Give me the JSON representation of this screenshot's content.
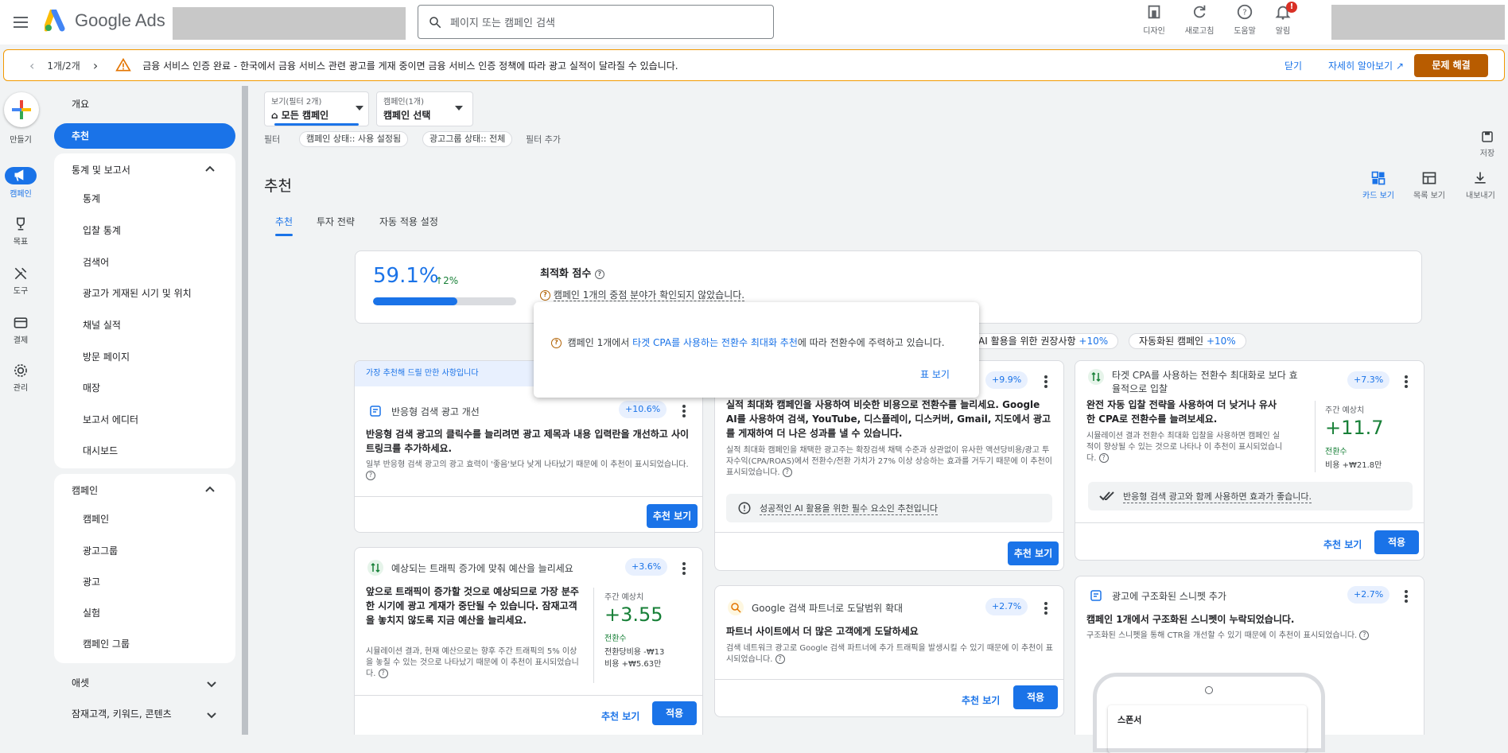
{
  "app": {
    "name": "Google Ads"
  },
  "search": {
    "placeholder": "페이지 또는 캠페인 검색"
  },
  "top_icons": [
    {
      "label": "디자인",
      "icon": "design-icon"
    },
    {
      "label": "새로고침",
      "icon": "refresh-icon"
    },
    {
      "label": "도움말",
      "icon": "help-icon"
    },
    {
      "label": "알림",
      "icon": "bell-icon",
      "badge": "!"
    }
  ],
  "banner": {
    "pager": "1개/2개",
    "title": "금융 서비스 인증 완료",
    "message": " - 한국에서 금융 서비스 관련 광고를 게재 중이면 금융 서비스 인증 정책에 따라 광고 실적이 달라질 수 있습니다.",
    "close": "닫기",
    "learn_more": "자세히 알아보기",
    "fix": "문제 해결"
  },
  "rail": [
    {
      "label": "만들기"
    },
    {
      "label": "캠페인"
    },
    {
      "label": "목표"
    },
    {
      "label": "도구"
    },
    {
      "label": "결제"
    },
    {
      "label": "관리"
    }
  ],
  "sidebar": {
    "overview": "개요",
    "recommendations": "추천",
    "stats_group": {
      "title": "통계 및 보고서",
      "items": [
        "통계",
        "입찰 통계",
        "검색어",
        "광고가 게재된 시기 및 위치",
        "채널 실적",
        "방문 페이지",
        "매장",
        "보고서 에디터",
        "대시보드"
      ]
    },
    "campaign_group": {
      "title": "캠페인",
      "items": [
        "캠페인",
        "광고그룹",
        "광고",
        "실험",
        "캠페인 그룹"
      ]
    },
    "assets": "애셋",
    "audience": "잠재고객, 키워드, 콘텐츠"
  },
  "filters": {
    "view_label": "보기(필터 2개)",
    "view_value": "모든 캠페인",
    "campaign_label": "캠페인(1개)",
    "campaign_value": "캠페인 선택",
    "filter_label": "필터",
    "chips": [
      "캠페인 상태:: 사용 설정됨",
      "광고그룹 상태:: 전체"
    ],
    "add_filter": "필터 추가",
    "save": "저장"
  },
  "page": {
    "title": "추천",
    "views": [
      "카드 보기",
      "목록 보기",
      "내보내기"
    ],
    "tabs": [
      "추천",
      "투자 전략",
      "자동 적용 설정"
    ]
  },
  "score": {
    "value": "59.1%",
    "delta": "2%",
    "progress": 0.591,
    "title": "최적화 점수",
    "subtitle": "캠페인 1개의 중점 분야가 확인되지 않았습니다."
  },
  "popup": {
    "text_before": "캠페인 1개에서 ",
    "link": "타겟 CPA를 사용하는 전환수 최대화 추천",
    "text_after": "에 따라 전환수에 주력하고 있습니다.",
    "more": "표 보기"
  },
  "categories": [
    {
      "label": "AI 활용을 위한 권장사항",
      "pct": "+10%"
    },
    {
      "label": "자동화된 캠페인",
      "pct": "+10%"
    }
  ],
  "cards": {
    "rsa": {
      "strip": "가장 추천해 드릴 만한 사항입니다",
      "head": "반응형 검색 광고 개선",
      "pct": "+10.6%",
      "title": "반응형 검색 광고의 클릭수를 늘리려면 광고 제목과 내용 입력란을 개선하고 사이트링크를 추가하세요.",
      "desc": "일부 반응형 검색 광고의 광고 효력이 '좋음'보다 낮게 나타났기 때문에 이 추천이 표시되었습니다.",
      "view": "추천 보기"
    },
    "pmax": {
      "pct": "+9.9%",
      "title": "실적 최대화 캠페인을 사용하여 비슷한 비용으로 전환수를 늘리세요. Google AI를 사용하여 검색, YouTube, 디스플레이, 디스커버, Gmail, 지도에서 광고를 게재하여 더 나은 성과를 낼 수 있습니다.",
      "desc": "실적 최대화 캠페인을 채택한 광고주는 확장검색 채택 수준과 상관없이 유사한 액션당비용/광고 투자수익(CPA/ROAS)에서 전환수/전환 가치가 27% 이상 상승하는 효과를 거두기 때문에 이 추천이 표시되었습니다.",
      "hint": "성공적인 AI 활용을 위한 필수 요소인 추천입니다",
      "view": "추천 보기"
    },
    "tcpa": {
      "head": "타겟 CPA를 사용하는 전환수 최대화로 보다 효율적으로 입찰",
      "pct": "+7.3%",
      "title": "완전 자동 입찰 전략을 사용하여 더 낮거나 유사한 CPA로 전환수를 늘려보세요.",
      "desc": "시뮬레이션 결과 전환수 최대화 입찰을 사용하면 캠페인 실적이 향상될 수 있는 것으로 나타나 이 추천이 표시되었습니다.",
      "stat_label": "주간 예상치",
      "stat_value": "+11.7",
      "stat_unit": "전환수",
      "cost": "비용 +₩21.8만",
      "hint": "반응형 검색 광고와 함께 사용하면 효과가 좋습니다.",
      "view": "추천 보기",
      "apply": "적용"
    },
    "budget": {
      "head": "예상되는 트래픽 증가에 맞춰 예산을 늘리세요",
      "pct": "+3.6%",
      "title": "앞으로 트래픽이 증가할 것으로 예상되므로 가장 분주한 시기에 광고 게재가 중단될 수 있습니다. 잠재고객을 놓치지 않도록 지금 예산을 늘리세요.",
      "desc": "시뮬레이션 결과, 현재 예산으로는 향후 주간 트래픽의 5% 이상을 놓칠 수 있는 것으로 나타났기 때문에 이 추천이 표시되었습니다.",
      "stat_label": "주간 예상치",
      "stat_value": "+3.55",
      "stat_unit": "전환수",
      "cpa": "전환당비용 -₩13",
      "cost": "비용 +₩5.63만",
      "view": "추천 보기",
      "apply": "적용"
    },
    "partners": {
      "head": "Google 검색 파트너로 도달범위 확대",
      "pct": "+2.7%",
      "title": "파트너 사이트에서 더 많은 고객에게 도달하세요",
      "desc": "검색 네트워크 광고로 Google 검색 파트너에 추가 트래픽을 발생시킬 수 있기 때문에 이 추천이 표시되었습니다.",
      "view": "추천 보기",
      "apply": "적용"
    },
    "snippet": {
      "head": "광고에 구조화된 스니펫 추가",
      "pct": "+2.7%",
      "title": "캠페인 1개에서 구조화된 스니펫이 누락되었습니다.",
      "desc": "구조화된 스니펫을 통해 CTR을 개선할 수 있기 때문에 이 추천이 표시되었습니다.",
      "phone_label": "스폰서"
    }
  },
  "colors": {
    "accent": "#1a73e8",
    "positive": "#188038",
    "warning": "#f29900",
    "fix_button": "#b85c00"
  }
}
